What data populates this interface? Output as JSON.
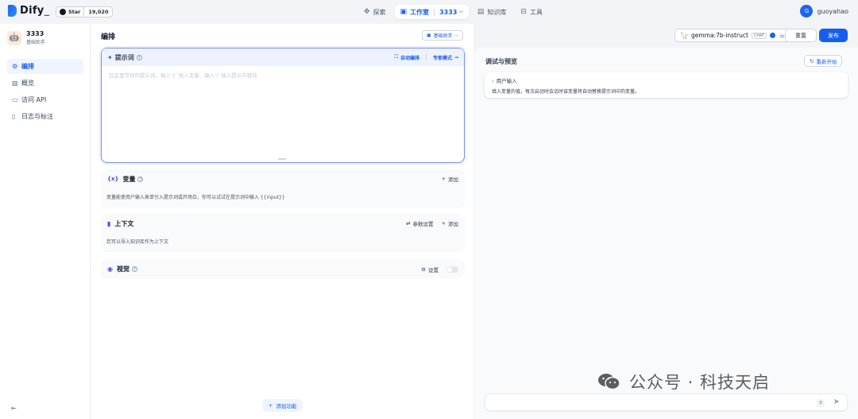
{
  "topbar": {
    "logo_text": "Dify",
    "star_label": "Star",
    "star_count": "19,020",
    "nav": {
      "explore": "探索",
      "studio": "工作室",
      "current_app": "3333",
      "knowledge": "知识库",
      "tools": "工具"
    },
    "user": {
      "avatar_letter": "G",
      "name": "guoyahao"
    }
  },
  "sidebar": {
    "app_name": "3333",
    "app_type": "基础助手",
    "items": [
      "编排",
      "概览",
      "访问 API",
      "日志与标注"
    ]
  },
  "center": {
    "title": "编排",
    "mode_label": "基础助手",
    "prompt": {
      "title": "提示词",
      "auto_label": "自动编排",
      "expert_label": "专家模式",
      "placeholder": "在这里写你的提示词，输入'{' 插入变量、输入'/' 插入提示内容块"
    },
    "variables": {
      "title": "变量",
      "add": "添加",
      "desc": "变量能使用户输入表单引入提示词或开场白，你可以试试在提示词中输入 {{input}}"
    },
    "context": {
      "title": "上下文",
      "params": "参数设置",
      "add": "添加",
      "desc": "您可以导入知识库作为上下文"
    },
    "vision": {
      "title": "视觉",
      "settings": "设置"
    },
    "add_feature": "添加功能"
  },
  "right": {
    "model_name": "gemma:7b-instruct",
    "model_tag": "CHAT",
    "reset": "重置",
    "publish": "发布",
    "debug_title": "调试与预览",
    "restart": "重新开始",
    "user_input_title": "用户输入",
    "user_input_desc": "填入变量的值，每次启动时会话时该变量将自动替换提示词中的变量。",
    "char_count": "0"
  },
  "watermark": "公众号 · 科技天启",
  "colors": {
    "primary": "#155eef",
    "accent_bg": "#eff4ff",
    "prompt_border": "#7c8ff4"
  }
}
